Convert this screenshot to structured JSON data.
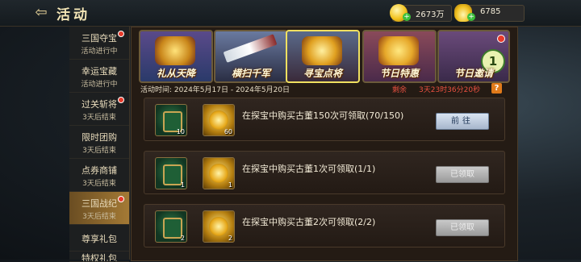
{
  "header": {
    "back_icon": "back-arrow-icon",
    "title": "活动",
    "coins": "2673万",
    "ingots": "6785",
    "coin_icon": "gold-coin-icon",
    "ingot_icon": "gold-ingot-icon"
  },
  "sidebar": {
    "items": [
      {
        "label": "三国夺宝",
        "sub": "活动进行中",
        "dot": true,
        "active": false
      },
      {
        "label": "幸运宝藏",
        "sub": "活动进行中",
        "dot": false,
        "active": false
      },
      {
        "label": "过关斩将",
        "sub": "3天后结束",
        "dot": true,
        "active": false
      },
      {
        "label": "限时团购",
        "sub": "3天后结束",
        "dot": false,
        "active": false
      },
      {
        "label": "点券商铺",
        "sub": "3天后结束",
        "dot": false,
        "active": false
      },
      {
        "label": "三国战纪",
        "sub": "3天后结束",
        "dot": true,
        "active": true
      },
      {
        "label": "尊享礼包",
        "sub": "",
        "dot": false,
        "active": false
      },
      {
        "label": "特权礼包",
        "sub": "",
        "dot": false,
        "active": false
      }
    ]
  },
  "tabs": [
    {
      "label": "礼从天降",
      "icon": "gold-pile-icon",
      "selected": false,
      "dot": false
    },
    {
      "label": "横扫千军",
      "icon": "sword-icon",
      "selected": false,
      "dot": false
    },
    {
      "label": "寻宝点将",
      "icon": "treasure-chest-icon",
      "selected": true,
      "dot": false
    },
    {
      "label": "节日特惠",
      "icon": "gold-bag-icon",
      "selected": false,
      "dot": false
    },
    {
      "label": "节日邀请",
      "icon": "invite-icon",
      "selected": false,
      "dot": true,
      "badge": "1"
    }
  ],
  "info": {
    "time": "活动时间:  2024年5月17日 - 2024年5月20日",
    "remain_label": "剩余",
    "countdown": "3天23时36分20秒",
    "help": "?"
  },
  "tasks": [
    {
      "desc": "在探宝中购买古董150次可领取(70/150)",
      "rewards": [
        {
          "type": "chest",
          "count": "10"
        },
        {
          "type": "helm",
          "count": "60"
        }
      ],
      "button": "前往",
      "state": "go"
    },
    {
      "desc": "在探宝中购买古董1次可领取(1/1)",
      "rewards": [
        {
          "type": "chest",
          "count": "1"
        },
        {
          "type": "helm",
          "count": "1"
        }
      ],
      "button": "已领取",
      "state": "done"
    },
    {
      "desc": "在探宝中购买古董2次可领取(2/2)",
      "rewards": [
        {
          "type": "chest",
          "count": "2"
        },
        {
          "type": "helm",
          "count": "2"
        }
      ],
      "button": "已领取",
      "state": "done"
    }
  ],
  "colors": {
    "accent": "#f0e060",
    "remain": "#e85040",
    "active_tab": "#a47a35"
  }
}
